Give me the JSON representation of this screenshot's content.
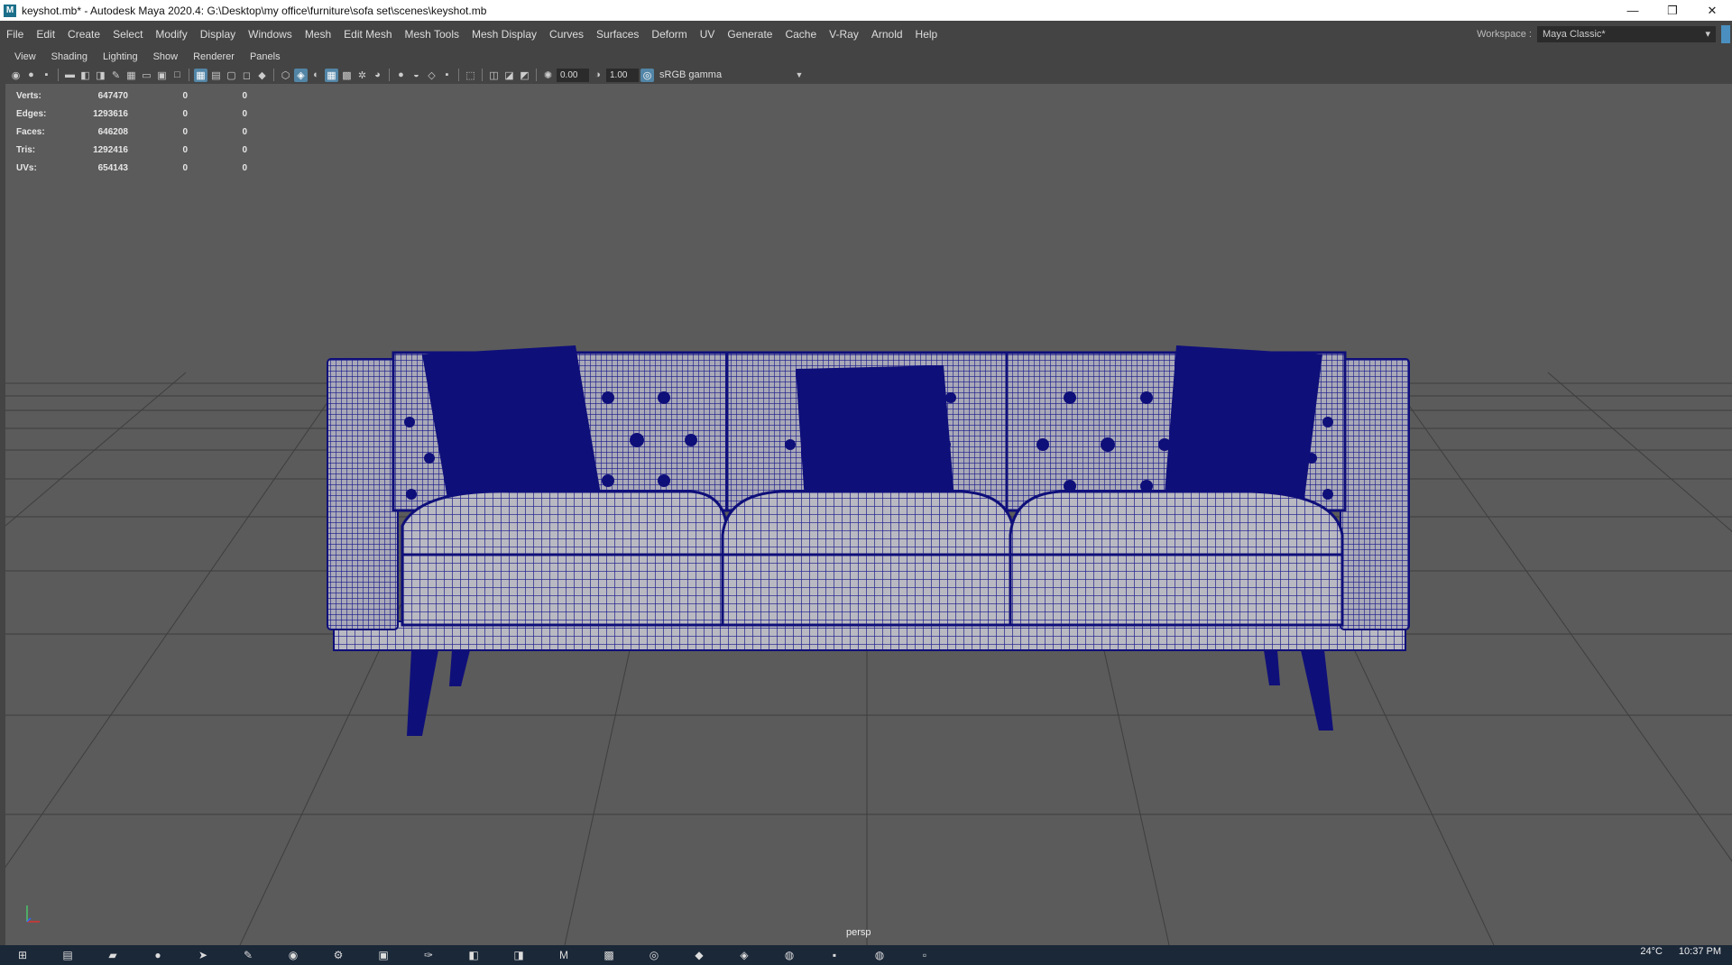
{
  "window": {
    "app_icon": "M",
    "title": "keyshot.mb* - Autodesk Maya 2020.4: G:\\Desktop\\my office\\furniture\\sofa set\\scenes\\keyshot.mb",
    "controls": {
      "minimize": "—",
      "restore": "❐",
      "close": "✕"
    }
  },
  "menubar": {
    "items": [
      "File",
      "Edit",
      "Create",
      "Select",
      "Modify",
      "Display",
      "Windows",
      "Mesh",
      "Edit Mesh",
      "Mesh Tools",
      "Mesh Display",
      "Curves",
      "Surfaces",
      "Deform",
      "UV",
      "Generate",
      "Cache",
      "V-Ray",
      "Arnold",
      "Help"
    ]
  },
  "workspace": {
    "label": "Workspace :",
    "value": "Maya Classic*"
  },
  "panel_menu": {
    "items": [
      "View",
      "Shading",
      "Lighting",
      "Show",
      "Renderer",
      "Panels"
    ]
  },
  "toolbar": {
    "exposure_value": "0.00",
    "gamma_value": "1.00",
    "color_management": "sRGB gamma"
  },
  "hud": {
    "rows": [
      {
        "label": "Verts:",
        "value": "647470",
        "sel": "0",
        "comp": "0"
      },
      {
        "label": "Edges:",
        "value": "1293616",
        "sel": "0",
        "comp": "0"
      },
      {
        "label": "Faces:",
        "value": "646208",
        "sel": "0",
        "comp": "0"
      },
      {
        "label": "Tris:",
        "value": "1292416",
        "sel": "0",
        "comp": "0"
      },
      {
        "label": "UVs:",
        "value": "654143",
        "sel": "0",
        "comp": "0"
      }
    ]
  },
  "viewport": {
    "camera": "persp",
    "background": "#5b5b5b",
    "wire_color": "#0f0f7a",
    "axis_labels": {
      "y": "y",
      "x": "x"
    }
  },
  "taskbar": {
    "time": "10:37 PM",
    "weather": "24°C"
  }
}
